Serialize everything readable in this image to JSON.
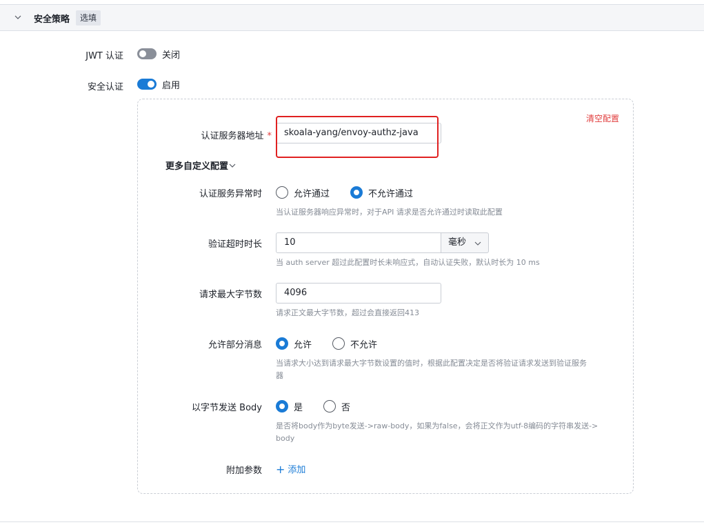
{
  "section": {
    "title": "安全策略",
    "tag": "选填"
  },
  "jwt": {
    "label": "JWT 认证",
    "state": "关闭",
    "enabled": false
  },
  "security": {
    "label": "安全认证",
    "state": "启用",
    "enabled": true
  },
  "panel": {
    "clear_label": "清空配置",
    "auth_server": {
      "label": "认证服务器地址",
      "required_mark": "*",
      "value": "skoala-yang/envoy-authz-java"
    },
    "more_config_label": "更多自定义配置",
    "service_error": {
      "label": "认证服务异常时",
      "options": [
        "允许通过",
        "不允许通过"
      ],
      "selected": "不允许通过",
      "help": "当认证服务器响应异常时，对于API 请求是否允许通过时读取此配置"
    },
    "timeout": {
      "label": "验证超时时长",
      "value": "10",
      "unit": "毫秒",
      "help": "当 auth server 超过此配置时长未响应式，自动认证失败，默认时长为 10 ms"
    },
    "max_bytes": {
      "label": "请求最大字节数",
      "value": "4096",
      "help": "请求正文最大字节数，超过会直接返回413"
    },
    "partial_message": {
      "label": "允许部分消息",
      "options": [
        "允许",
        "不允许"
      ],
      "selected": "允许",
      "help_line1": "当请求大小达到请求最大字节数设置的值时，根据此配置决定是否将验证请求发送到验证服务",
      "help_line2": "器"
    },
    "send_bytes": {
      "label": "以字节发送 Body",
      "options": [
        "是",
        "否"
      ],
      "selected": "是",
      "help_line1": "是否将body作为byte发送->raw-body，如果为false，会将正文作为utf-8编码的字符串发送->",
      "help_line2": "body"
    },
    "extra_params": {
      "label": "附加参数",
      "add_label": "添加"
    }
  }
}
